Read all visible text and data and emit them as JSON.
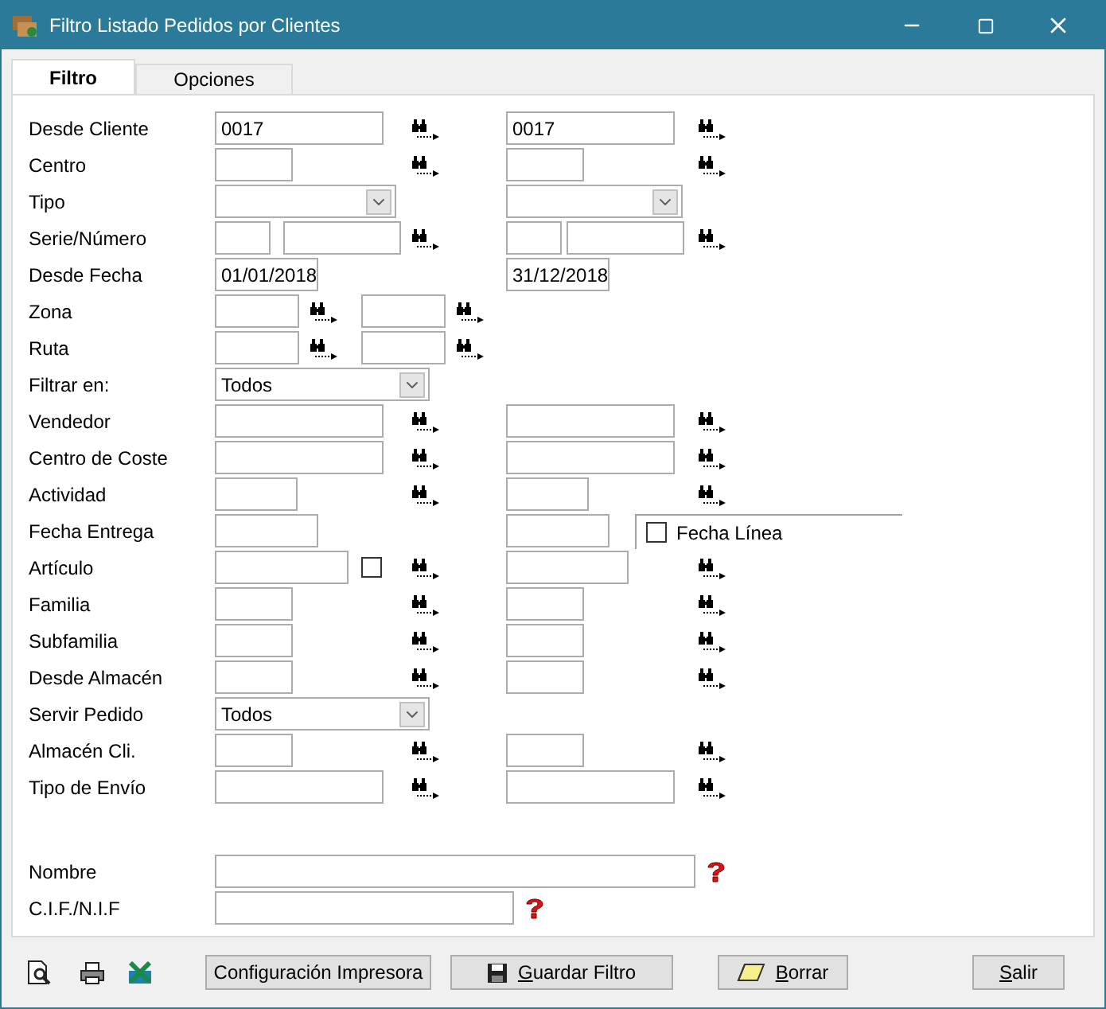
{
  "window": {
    "title": "Filtro Listado Pedidos por Clientes"
  },
  "tabs": [
    {
      "label": "Filtro",
      "selected": true
    },
    {
      "label": "Opciones",
      "selected": false
    }
  ],
  "rows": [
    {
      "label": "Desde Cliente",
      "kind": "range",
      "from": [
        {
          "kind": "text",
          "value": "0017"
        }
      ],
      "to": [
        {
          "kind": "text",
          "value": "0017"
        }
      ],
      "lookup": true
    },
    {
      "label": "Centro",
      "kind": "range",
      "from": [
        {
          "kind": "text"
        }
      ],
      "to": [
        {
          "kind": "text"
        }
      ],
      "lookup": true
    },
    {
      "label": "Tipo",
      "kind": "range",
      "from": [
        {
          "kind": "select"
        }
      ],
      "to": [
        {
          "kind": "select"
        }
      ],
      "lookup": false
    },
    {
      "label": "Serie/Número",
      "kind": "range",
      "from": [
        {
          "kind": "text"
        },
        {
          "kind": "text"
        }
      ],
      "to": [
        {
          "kind": "text"
        },
        {
          "kind": "text"
        }
      ],
      "lookup": true
    },
    {
      "label": "Desde Fecha",
      "kind": "range",
      "from": [
        {
          "kind": "text",
          "value": "01/01/2018"
        }
      ],
      "to": [
        {
          "kind": "text",
          "value": "31/12/2018"
        }
      ],
      "lookup": false
    },
    {
      "label": "Zona",
      "kind": "compact",
      "from": [
        {
          "kind": "text"
        }
      ],
      "to": [
        {
          "kind": "text"
        }
      ],
      "lookup": true
    },
    {
      "label": "Ruta",
      "kind": "compact",
      "from": [
        {
          "kind": "text"
        }
      ],
      "to": [
        {
          "kind": "text"
        }
      ],
      "lookup": true
    },
    {
      "label": "Filtrar en:",
      "kind": "single",
      "from": [
        {
          "kind": "select",
          "value": "Todos"
        }
      ]
    },
    {
      "label": "Vendedor",
      "kind": "range",
      "from": [
        {
          "kind": "text"
        }
      ],
      "to": [
        {
          "kind": "text"
        }
      ],
      "lookup": true
    },
    {
      "label": "Centro de Coste",
      "kind": "range",
      "from": [
        {
          "kind": "text"
        }
      ],
      "to": [
        {
          "kind": "text"
        }
      ],
      "lookup": true
    },
    {
      "label": "Actividad",
      "kind": "range",
      "from": [
        {
          "kind": "text"
        }
      ],
      "to": [
        {
          "kind": "text"
        }
      ],
      "lookup": true
    },
    {
      "label": "Fecha Entrega",
      "kind": "range",
      "from": [
        {
          "kind": "text"
        }
      ],
      "to": [
        {
          "kind": "text"
        }
      ],
      "lookup": false,
      "option": {
        "label": "Fecha Línea",
        "checked": false
      }
    },
    {
      "label": "Artículo",
      "kind": "range",
      "from": [
        {
          "kind": "text"
        },
        {
          "kind": "checkbox",
          "checked": false
        }
      ],
      "to": [
        {
          "kind": "text"
        }
      ],
      "lookup": true
    },
    {
      "label": "Familia",
      "kind": "range",
      "from": [
        {
          "kind": "text"
        }
      ],
      "to": [
        {
          "kind": "text"
        }
      ],
      "lookup": true
    },
    {
      "label": "Subfamilia",
      "kind": "range",
      "from": [
        {
          "kind": "text"
        }
      ],
      "to": [
        {
          "kind": "text"
        }
      ],
      "lookup": true
    },
    {
      "label": "Desde Almacén",
      "kind": "range",
      "from": [
        {
          "kind": "text"
        }
      ],
      "to": [
        {
          "kind": "text"
        }
      ],
      "lookup": true
    },
    {
      "label": "Servir Pedido",
      "kind": "single",
      "from": [
        {
          "kind": "select",
          "value": "Todos"
        }
      ]
    },
    {
      "label": "Almacén Cli.",
      "kind": "range",
      "from": [
        {
          "kind": "text"
        }
      ],
      "to": [
        {
          "kind": "text"
        }
      ],
      "lookup": true
    },
    {
      "label": "Tipo de Envío",
      "kind": "range",
      "from": [
        {
          "kind": "text"
        }
      ],
      "to": [
        {
          "kind": "text"
        }
      ],
      "lookup": true
    }
  ],
  "identity_rows": [
    {
      "label": "Nombre"
    },
    {
      "label": "C.I.F./N.I.F"
    }
  ],
  "buttons": [
    {
      "label": "Configuración Impresora",
      "mnemonic": false
    },
    {
      "label": "Guardar Filtro",
      "mnemonic": true
    },
    {
      "label": "Borrar",
      "mnemonic": true
    },
    {
      "label": "Salir",
      "mnemonic": true
    }
  ]
}
